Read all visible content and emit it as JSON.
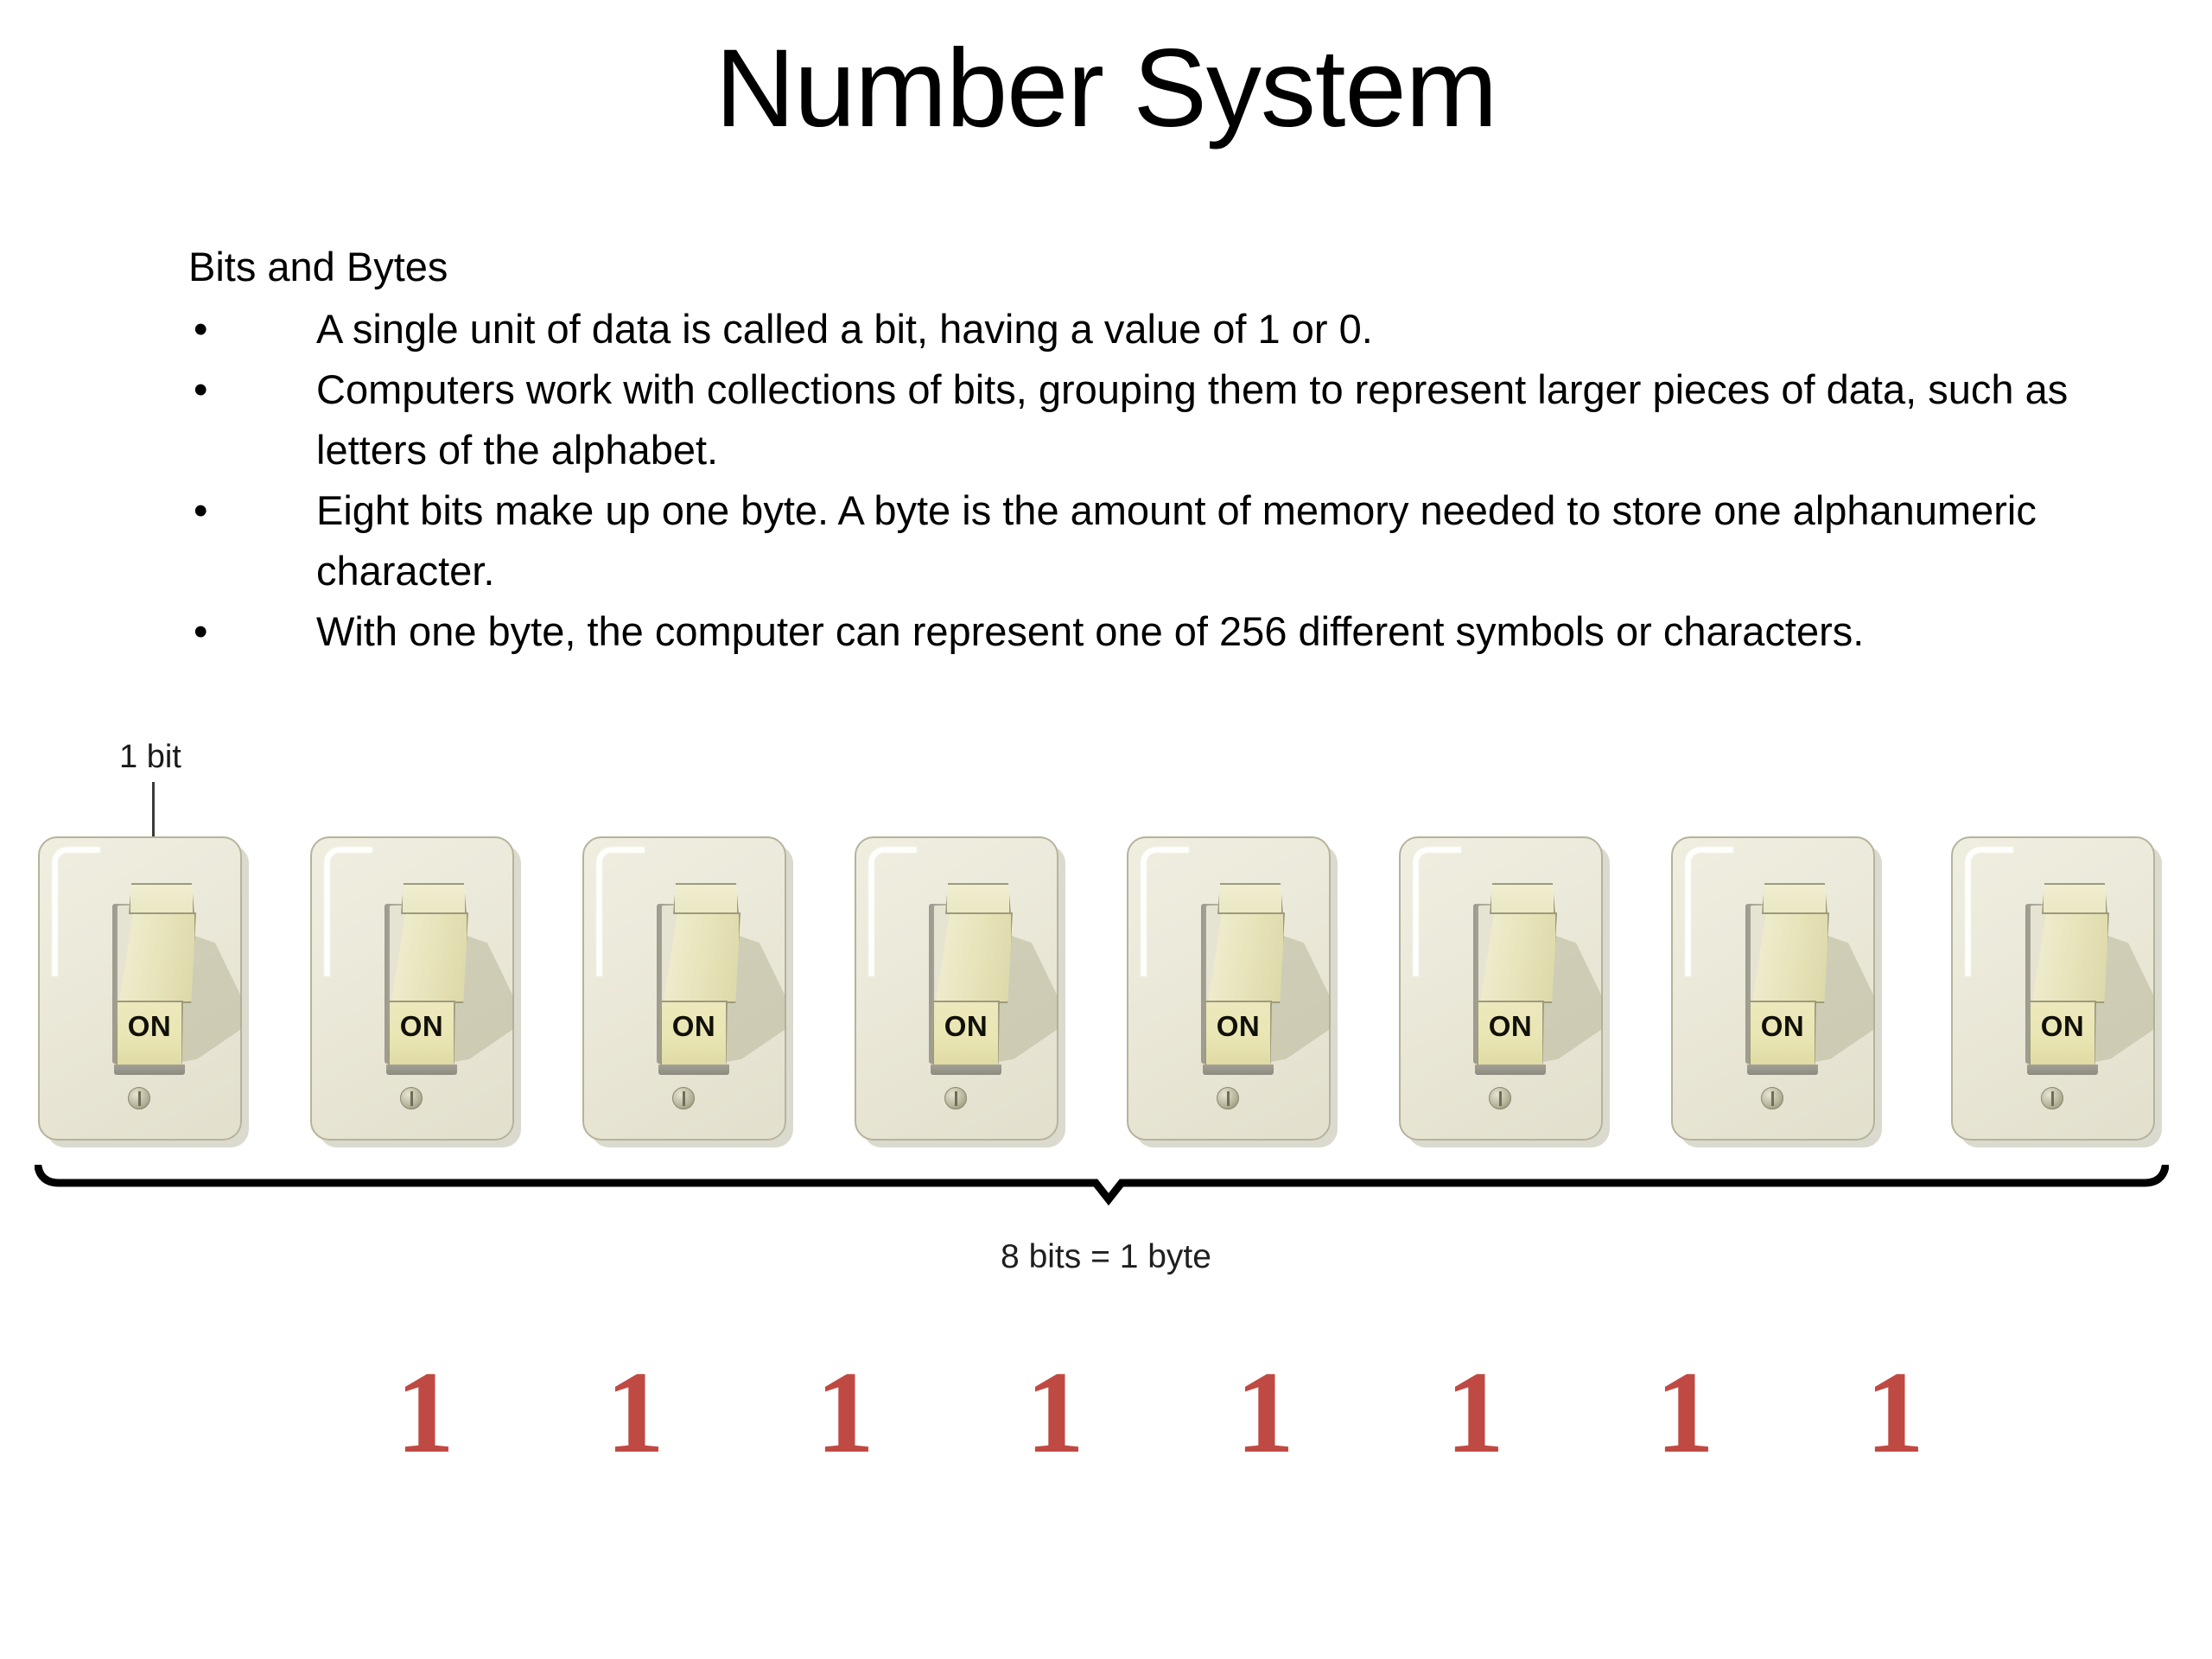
{
  "slide": {
    "title": "Number System",
    "heading": "Bits and Bytes",
    "bullet_marker": "•",
    "bullets": [
      "A single unit of data is called a bit, having a value of 1 or 0.",
      "Computers work with collections of bits, grouping them to represent larger pieces of data, such as letters of the alphabet.",
      "Eight bits make up one byte. A byte is the amount of memory needed to store one alphanumeric character.",
      "With one byte, the computer can represent one of 256 different symbols or characters."
    ]
  },
  "diagram": {
    "bit_callout": "1 bit",
    "byte_caption": "8 bits = 1 byte",
    "switch_state_label": "ON",
    "switch_count": 8,
    "switches": [
      {
        "state": "ON"
      },
      {
        "state": "ON"
      },
      {
        "state": "ON"
      },
      {
        "state": "ON"
      },
      {
        "state": "ON"
      },
      {
        "state": "ON"
      },
      {
        "state": "ON"
      },
      {
        "state": "ON"
      }
    ],
    "binary_digits": [
      "1",
      "1",
      "1",
      "1",
      "1",
      "1",
      "1",
      "1"
    ],
    "colors": {
      "digit_red": "#bf4a43",
      "plate_cream": "#ece9da",
      "lever_tan": "#e7e3b8",
      "background": "#ffffff",
      "text_black": "#000000"
    }
  }
}
